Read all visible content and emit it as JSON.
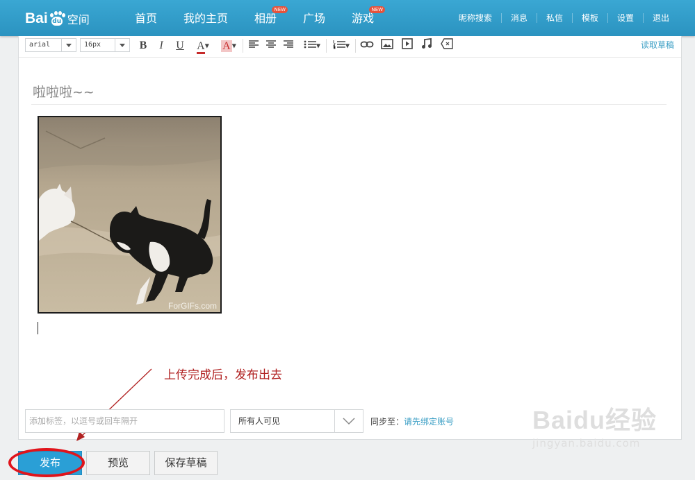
{
  "app": {
    "logo_text_left": "Bai",
    "logo_text_paw": "du",
    "logo_text_right": "空间"
  },
  "nav": {
    "items": [
      {
        "label": "首页",
        "badge": ""
      },
      {
        "label": "我的主页",
        "badge": ""
      },
      {
        "label": "相册",
        "badge": "NEW"
      },
      {
        "label": "广场",
        "badge": ""
      },
      {
        "label": "游戏",
        "badge": "NEW"
      }
    ],
    "right": [
      "昵称搜索",
      "消息",
      "私信",
      "模板",
      "设置",
      "退出"
    ]
  },
  "toolbar": {
    "font_family": "arial",
    "font_size": "16px",
    "bold": "B",
    "italic": "I",
    "underline": "U",
    "font_color": "A",
    "bg_color": "A",
    "draft_link": "读取草稿"
  },
  "post": {
    "title": "啦啦啦~~",
    "image_watermark": "ForGIFs.com"
  },
  "annotation": "上传完成后，发布出去",
  "bottom": {
    "tag_placeholder": "添加标签，以逗号或回车隔开",
    "visibility": "所有人可见",
    "sync_label": "同步至：",
    "sync_link": "请先绑定账号"
  },
  "buttons": {
    "publish": "发布",
    "preview": "预览",
    "save_draft": "保存草稿"
  },
  "watermark": {
    "brand": "Baidu经验",
    "url": "jingyan.baidu.com"
  },
  "colors": {
    "header": "#2f9cc8",
    "publish_button": "#2a9fd6",
    "annotation": "#b12222",
    "highlight_circle": "#e0141b",
    "link": "#3c9fc5"
  }
}
